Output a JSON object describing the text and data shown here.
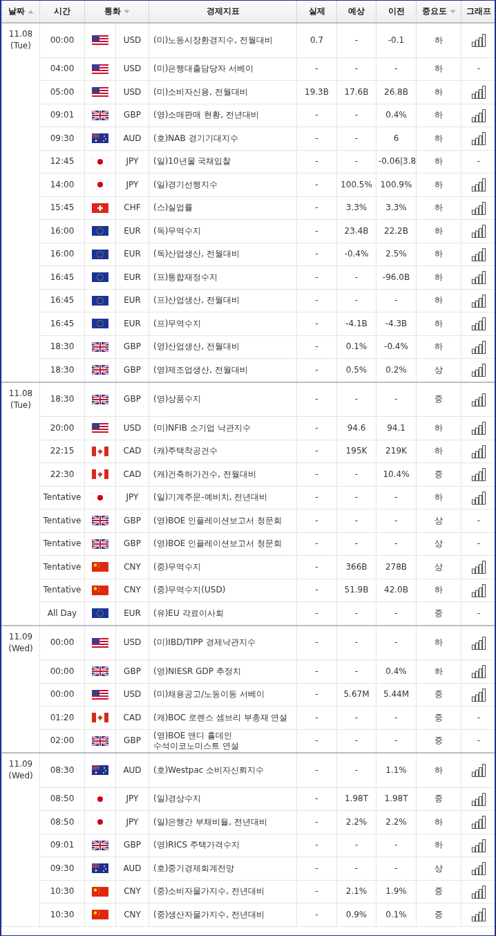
{
  "table": {
    "columns": [
      {
        "label": "날짜",
        "sort": {
          "kind": "asc"
        }
      },
      {
        "label": "시간"
      },
      {
        "label": "통화",
        "sort": {
          "kind": "desc"
        }
      },
      {
        "label": "경제지표"
      },
      {
        "label": "실제"
      },
      {
        "label": "예상"
      },
      {
        "label": "이전"
      },
      {
        "label": "중요도",
        "sort": {
          "kind": "desc"
        }
      },
      {
        "label": "그래프"
      }
    ],
    "groups": [
      {
        "date": "11.08",
        "day": "(Tue)",
        "rows": [
          {
            "time": "00:00",
            "flag": {
              "kind": "us"
            },
            "currency": "USD",
            "indicator": "(미)노동시장환경지수, 전월대비",
            "actual": "0.7",
            "forecast": "-",
            "previous": "-0.1",
            "importance": "하",
            "graph": {
              "kind": "chart"
            }
          },
          {
            "time": "04:00",
            "flag": {
              "kind": "us"
            },
            "currency": "USD",
            "indicator": "(미)은행대출담당자 서베이",
            "actual": "-",
            "forecast": "-",
            "previous": "-",
            "importance": "하",
            "graph": {
              "kind": "text",
              "text": "-"
            }
          },
          {
            "time": "05:00",
            "flag": {
              "kind": "us"
            },
            "currency": "USD",
            "indicator": "(미)소비자신용, 전월대비",
            "actual": "19.3B",
            "forecast": "17.6B",
            "previous": "26.8B",
            "importance": "하",
            "graph": {
              "kind": "chart"
            }
          },
          {
            "time": "09:01",
            "flag": {
              "kind": "gb"
            },
            "currency": "GBP",
            "indicator": "(영)소매판매 현황, 전년대비",
            "actual": "-",
            "forecast": "-",
            "previous": "0.4%",
            "importance": "하",
            "graph": {
              "kind": "chart"
            }
          },
          {
            "time": "09:30",
            "flag": {
              "kind": "au"
            },
            "currency": "AUD",
            "indicator": "(호)NAB 경기기대지수",
            "actual": "-",
            "forecast": "-",
            "previous": "6",
            "importance": "하",
            "graph": {
              "kind": "chart"
            }
          },
          {
            "time": "12:45",
            "flag": {
              "kind": "jp"
            },
            "currency": "JPY",
            "indicator": "(일)10년물 국채입찰",
            "actual": "-",
            "forecast": "-",
            "previous": "-0.06|3.8",
            "importance": "하",
            "graph": {
              "kind": "text",
              "text": "-"
            }
          },
          {
            "time": "14:00",
            "flag": {
              "kind": "jp"
            },
            "currency": "JPY",
            "indicator": "(일)경기선행지수",
            "actual": "-",
            "forecast": "100.5%",
            "previous": "100.9%",
            "importance": "하",
            "graph": {
              "kind": "chart"
            }
          },
          {
            "time": "15:45",
            "flag": {
              "kind": "ch"
            },
            "currency": "CHF",
            "indicator": "(스)실업률",
            "actual": "-",
            "forecast": "3.3%",
            "previous": "3.3%",
            "importance": "하",
            "graph": {
              "kind": "chart"
            }
          },
          {
            "time": "16:00",
            "flag": {
              "kind": "eu"
            },
            "currency": "EUR",
            "indicator": "(독)무역수지",
            "actual": "-",
            "forecast": "23.4B",
            "previous": "22.2B",
            "importance": "하",
            "graph": {
              "kind": "chart"
            }
          },
          {
            "time": "16:00",
            "flag": {
              "kind": "eu"
            },
            "currency": "EUR",
            "indicator": "(독)산업생산, 전월대비",
            "actual": "-",
            "forecast": "-0.4%",
            "previous": "2.5%",
            "importance": "하",
            "graph": {
              "kind": "chart"
            }
          },
          {
            "time": "16:45",
            "flag": {
              "kind": "eu"
            },
            "currency": "EUR",
            "indicator": "(프)통합재정수지",
            "actual": "-",
            "forecast": "-",
            "previous": "-96.0B",
            "importance": "하",
            "graph": {
              "kind": "chart"
            }
          },
          {
            "time": "16:45",
            "flag": {
              "kind": "eu"
            },
            "currency": "EUR",
            "indicator": "(프)산업생산, 전월대비",
            "actual": "-",
            "forecast": "-",
            "previous": "-",
            "importance": "하",
            "graph": {
              "kind": "chart"
            }
          },
          {
            "time": "16:45",
            "flag": {
              "kind": "eu"
            },
            "currency": "EUR",
            "indicator": "(프)무역수지",
            "actual": "-",
            "forecast": "-4.1B",
            "previous": "-4.3B",
            "importance": "하",
            "graph": {
              "kind": "chart"
            }
          },
          {
            "time": "18:30",
            "flag": {
              "kind": "gb"
            },
            "currency": "GBP",
            "indicator": "(영)산업생산, 전월대비",
            "actual": "-",
            "forecast": "0.1%",
            "previous": "-0.4%",
            "importance": "하",
            "graph": {
              "kind": "chart"
            }
          },
          {
            "time": "18:30",
            "flag": {
              "kind": "gb"
            },
            "currency": "GBP",
            "indicator": "(영)제조업생산, 전월대비",
            "actual": "-",
            "forecast": "0.5%",
            "previous": "0.2%",
            "importance": "상",
            "graph": {
              "kind": "chart"
            }
          }
        ]
      },
      {
        "date": "11.08",
        "day": "(Tue)",
        "rows": [
          {
            "time": "18:30",
            "flag": {
              "kind": "gb"
            },
            "currency": "GBP",
            "indicator": "(영)상품수지",
            "actual": "-",
            "forecast": "-",
            "previous": "-",
            "importance": "중",
            "graph": {
              "kind": "chart"
            }
          },
          {
            "time": "20:00",
            "flag": {
              "kind": "us"
            },
            "currency": "USD",
            "indicator": "(미)NFIB 소기업 낙관지수",
            "actual": "-",
            "forecast": "94.6",
            "previous": "94.1",
            "importance": "하",
            "graph": {
              "kind": "chart"
            }
          },
          {
            "time": "22:15",
            "flag": {
              "kind": "ca"
            },
            "currency": "CAD",
            "indicator": "(캐)주택착공건수",
            "actual": "-",
            "forecast": "195K",
            "previous": "219K",
            "importance": "하",
            "graph": {
              "kind": "chart"
            }
          },
          {
            "time": "22:30",
            "flag": {
              "kind": "ca"
            },
            "currency": "CAD",
            "indicator": "(캐)건축허가건수, 전월대비",
            "actual": "-",
            "forecast": "-",
            "previous": "10.4%",
            "importance": "중",
            "graph": {
              "kind": "chart"
            }
          },
          {
            "time": "Tentative",
            "flag": {
              "kind": "jp"
            },
            "currency": "JPY",
            "indicator": "(일)기계주문-예비치, 전년대비",
            "actual": "-",
            "forecast": "-",
            "previous": "-",
            "importance": "하",
            "graph": {
              "kind": "chart"
            }
          },
          {
            "time": "Tentative",
            "flag": {
              "kind": "gb"
            },
            "currency": "GBP",
            "indicator": "(영)BOE 인플레이션보고서 청문회",
            "actual": "-",
            "forecast": "-",
            "previous": "-",
            "importance": "상",
            "graph": {
              "kind": "text",
              "text": "-"
            }
          },
          {
            "time": "Tentative",
            "flag": {
              "kind": "gb"
            },
            "currency": "GBP",
            "indicator": "(영)BOE 인플레이션보고서 청문회",
            "actual": "-",
            "forecast": "-",
            "previous": "-",
            "importance": "상",
            "graph": {
              "kind": "text",
              "text": "-"
            }
          },
          {
            "time": "Tentative",
            "flag": {
              "kind": "cn"
            },
            "currency": "CNY",
            "indicator": "(중)무역수지",
            "actual": "-",
            "forecast": "366B",
            "previous": "278B",
            "importance": "상",
            "graph": {
              "kind": "chart"
            }
          },
          {
            "time": "Tentative",
            "flag": {
              "kind": "cn"
            },
            "currency": "CNY",
            "indicator": "(중)무역수지(USD)",
            "actual": "-",
            "forecast": "51.9B",
            "previous": "42.0B",
            "importance": "하",
            "graph": {
              "kind": "chart"
            }
          },
          {
            "time": "All Day",
            "flag": {
              "kind": "eu"
            },
            "currency": "EUR",
            "indicator": "(유)EU 각료이사회",
            "actual": "-",
            "forecast": "-",
            "previous": "-",
            "importance": "중",
            "graph": {
              "kind": "text",
              "text": "-"
            }
          }
        ]
      },
      {
        "date": "11.09",
        "day": "(Wed)",
        "rows": [
          {
            "time": "00:00",
            "flag": {
              "kind": "us"
            },
            "currency": "USD",
            "indicator": "(미)IBD/TIPP 경제낙관지수",
            "actual": "-",
            "forecast": "-",
            "previous": "-",
            "importance": "하",
            "graph": {
              "kind": "chart"
            }
          },
          {
            "time": "00:00",
            "flag": {
              "kind": "gb"
            },
            "currency": "GBP",
            "indicator": "(영)NIESR GDP 추정치",
            "actual": "-",
            "forecast": "-",
            "previous": "0.4%",
            "importance": "하",
            "graph": {
              "kind": "chart"
            }
          },
          {
            "time": "00:00",
            "flag": {
              "kind": "us"
            },
            "currency": "USD",
            "indicator": "(미)채용공고/노동이동 서베이",
            "actual": "-",
            "forecast": "5.67M",
            "previous": "5.44M",
            "importance": "중",
            "graph": {
              "kind": "chart"
            }
          },
          {
            "time": "01:20",
            "flag": {
              "kind": "ca"
            },
            "currency": "CAD",
            "indicator": "(캐)BOC 로렌스 셈브리 부총재 연설",
            "actual": "-",
            "forecast": "-",
            "previous": "-",
            "importance": "중",
            "graph": {
              "kind": "text",
              "text": "-"
            }
          },
          {
            "time": "02:00",
            "flag": {
              "kind": "gb"
            },
            "currency": "GBP",
            "indicator": "(영)BOE 앤디 홀데인 수석이코노미스트 연설",
            "actual": "-",
            "forecast": "-",
            "previous": "-",
            "importance": "중",
            "graph": {
              "kind": "text",
              "text": "-"
            }
          }
        ]
      },
      {
        "date": "11.09",
        "day": "(Wed)",
        "rows": [
          {
            "time": "08:30",
            "flag": {
              "kind": "au"
            },
            "currency": "AUD",
            "indicator": "(호)Westpac 소비자신뢰지수",
            "actual": "-",
            "forecast": "-",
            "previous": "1.1%",
            "importance": "하",
            "graph": {
              "kind": "chart"
            }
          },
          {
            "time": "08:50",
            "flag": {
              "kind": "jp"
            },
            "currency": "JPY",
            "indicator": "(일)경상수지",
            "actual": "-",
            "forecast": "1.98T",
            "previous": "1.98T",
            "importance": "중",
            "graph": {
              "kind": "chart"
            }
          },
          {
            "time": "08:50",
            "flag": {
              "kind": "jp"
            },
            "currency": "JPY",
            "indicator": "(일)은행간 부채비율, 전년대비",
            "actual": "-",
            "forecast": "2.2%",
            "previous": "2.2%",
            "importance": "하",
            "graph": {
              "kind": "chart"
            }
          },
          {
            "time": "09:01",
            "flag": {
              "kind": "gb"
            },
            "currency": "GBP",
            "indicator": "(영)RICS 주택가격수지",
            "actual": "-",
            "forecast": "-",
            "previous": "-",
            "importance": "하",
            "graph": {
              "kind": "chart"
            }
          },
          {
            "time": "09:30",
            "flag": {
              "kind": "au"
            },
            "currency": "AUD",
            "indicator": "(호)중기경제회계전망",
            "actual": "-",
            "forecast": "-",
            "previous": "-",
            "importance": "상",
            "graph": {
              "kind": "chart"
            }
          },
          {
            "time": "10:30",
            "flag": {
              "kind": "cn"
            },
            "currency": "CNY",
            "indicator": "(중)소비자물가지수, 전년대비",
            "actual": "-",
            "forecast": "2.1%",
            "previous": "1.9%",
            "importance": "중",
            "graph": {
              "kind": "chart"
            }
          },
          {
            "time": "10:30",
            "flag": {
              "kind": "cn"
            },
            "currency": "CNY",
            "indicator": "(중)생산자물가지수, 전년대비",
            "actual": "-",
            "forecast": "0.9%",
            "previous": "0.1%",
            "importance": "중",
            "graph": {
              "kind": "chart"
            }
          }
        ]
      }
    ]
  }
}
